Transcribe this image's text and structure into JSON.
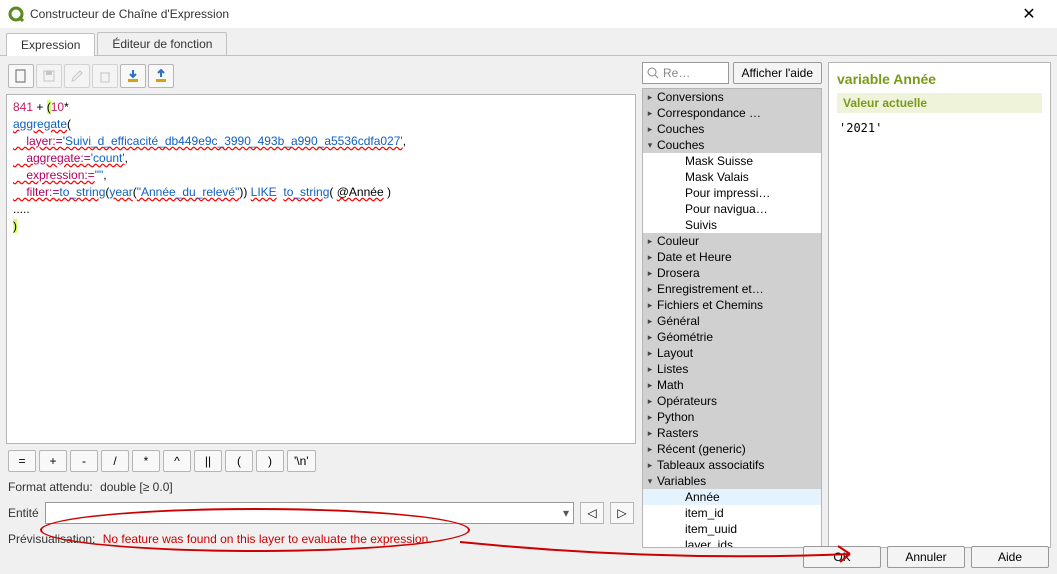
{
  "title": "Constructeur de Chaîne d'Expression",
  "tabs": {
    "expression": "Expression",
    "func_editor": "Éditeur de fonction"
  },
  "editor_lines": [
    {
      "segments": [
        {
          "t": "841",
          "cls": "num"
        },
        {
          "t": " + ",
          "cls": ""
        },
        {
          "t": "(",
          "cls": "hl"
        },
        {
          "t": "10",
          "cls": "num"
        },
        {
          "t": "*",
          "cls": ""
        }
      ]
    },
    {
      "segments": [
        {
          "t": "aggregate",
          "cls": "func underline"
        },
        {
          "t": "(",
          "cls": ""
        }
      ]
    },
    {
      "segments": [
        {
          "t": "    layer:=",
          "cls": "arg underline"
        },
        {
          "t": "'Suivi_d_efficacité_db449e9c_3990_493b_a990_a5536cdfa027'",
          "cls": "str underline"
        },
        {
          "t": ",",
          "cls": ""
        }
      ]
    },
    {
      "segments": [
        {
          "t": "    aggregate:=",
          "cls": "arg underline"
        },
        {
          "t": "'count'",
          "cls": "str underline"
        },
        {
          "t": ",",
          "cls": ""
        }
      ]
    },
    {
      "segments": [
        {
          "t": "    expression:=",
          "cls": "arg underline"
        },
        {
          "t": "\"\"",
          "cls": "str"
        },
        {
          "t": ",",
          "cls": ""
        }
      ]
    },
    {
      "segments": [
        {
          "t": "    filter:=",
          "cls": "arg underline"
        },
        {
          "t": "to_string",
          "cls": "func underline"
        },
        {
          "t": "(",
          "cls": ""
        },
        {
          "t": "year",
          "cls": "func underline"
        },
        {
          "t": "(",
          "cls": ""
        },
        {
          "t": "\"Année_du_relevé\"",
          "cls": "str underline"
        },
        {
          "t": ")) ",
          "cls": ""
        },
        {
          "t": "LIKE",
          "cls": "kw underline"
        },
        {
          "t": "  ",
          "cls": ""
        },
        {
          "t": "to_string",
          "cls": "func underline"
        },
        {
          "t": "( ",
          "cls": ""
        },
        {
          "t": "@Année",
          "cls": "var underline"
        },
        {
          "t": " )",
          "cls": ""
        }
      ]
    },
    {
      "segments": [
        {
          "t": ".....",
          "cls": ""
        }
      ]
    },
    {
      "segments": [
        {
          "t": ")",
          "cls": "hl"
        }
      ]
    }
  ],
  "operators": [
    "=",
    "+",
    "-",
    "/",
    "*",
    "^",
    "||",
    "(",
    ")",
    "'\\n'"
  ],
  "format_label": "Format attendu:",
  "format_value": "double [≥ 0.0]",
  "entity_label": "Entité",
  "entity_value": "",
  "preview_label": "Prévisualisation:",
  "preview_error": "No feature was found on this layer to evaluate the expression.",
  "search_placeholder": "Re…",
  "help_button": "Afficher l'aide",
  "tree": [
    {
      "type": "group",
      "label": "Conversions",
      "state": "▸"
    },
    {
      "type": "group",
      "label": "Correspondance …",
      "state": "▸"
    },
    {
      "type": "group",
      "label": "Couches",
      "state": "▸"
    },
    {
      "type": "group",
      "label": "Couches",
      "state": "▾"
    },
    {
      "type": "child",
      "label": "Mask Suisse"
    },
    {
      "type": "child",
      "label": "Mask Valais"
    },
    {
      "type": "child",
      "label": "Pour impressi…"
    },
    {
      "type": "child",
      "label": "Pour navigua…"
    },
    {
      "type": "child",
      "label": "Suivis"
    },
    {
      "type": "group",
      "label": "Couleur",
      "state": "▸"
    },
    {
      "type": "group",
      "label": "Date et Heure",
      "state": "▸"
    },
    {
      "type": "group",
      "label": "Drosera",
      "state": "▸"
    },
    {
      "type": "group",
      "label": "Enregistrement et…",
      "state": "▸"
    },
    {
      "type": "group",
      "label": "Fichiers et Chemins",
      "state": "▸"
    },
    {
      "type": "group",
      "label": "Général",
      "state": "▸"
    },
    {
      "type": "group",
      "label": "Géométrie",
      "state": "▸"
    },
    {
      "type": "group",
      "label": "Layout",
      "state": "▸"
    },
    {
      "type": "group",
      "label": "Listes",
      "state": "▸"
    },
    {
      "type": "group",
      "label": "Math",
      "state": "▸"
    },
    {
      "type": "group",
      "label": "Opérateurs",
      "state": "▸"
    },
    {
      "type": "group",
      "label": "Python",
      "state": "▸"
    },
    {
      "type": "group",
      "label": "Rasters",
      "state": "▸"
    },
    {
      "type": "group",
      "label": "Récent (generic)",
      "state": "▸"
    },
    {
      "type": "group",
      "label": "Tableaux associatifs",
      "state": "▸"
    },
    {
      "type": "group",
      "label": "Variables",
      "state": "▾"
    },
    {
      "type": "child",
      "label": "Année",
      "selected": true
    },
    {
      "type": "child",
      "label": "item_id"
    },
    {
      "type": "child",
      "label": "item_uuid"
    },
    {
      "type": "child",
      "label": "layer_ids"
    }
  ],
  "right_panel": {
    "title": "variable Année",
    "value_header": "Valeur actuelle",
    "value": "'2021'"
  },
  "buttons": {
    "ok": "OK",
    "cancel": "Annuler",
    "help": "Aide"
  }
}
